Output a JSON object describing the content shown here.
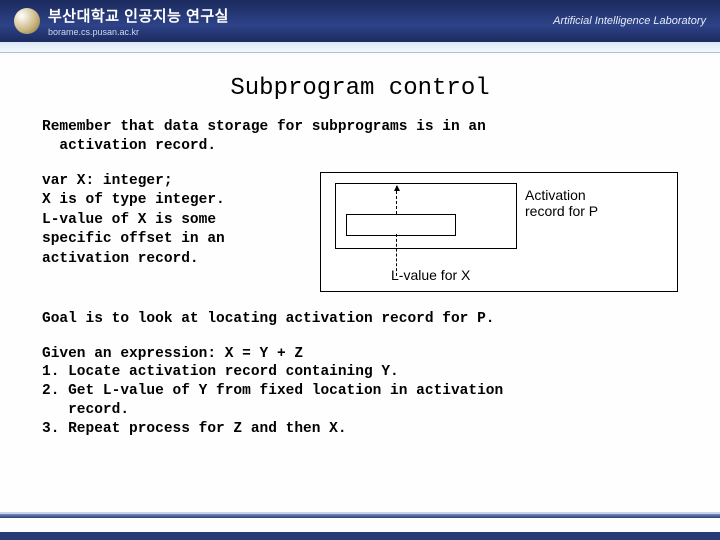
{
  "header": {
    "lab_name_kr": "부산대학교 인공지능 연구실",
    "lab_url": "borame.cs.pusan.ac.kr",
    "lab_name_en": "Artificial Intelligence Laboratory"
  },
  "title": "Subprogram control",
  "intro": "Remember that data storage for subprograms is in an\n  activation record.",
  "code_block": "var X: integer;\nX is of type integer.\nL-value of X is some\nspecific offset in an\nactivation record.",
  "diagram": {
    "ar_label": "Activation\nrecord for P",
    "lvalue_label": "L-value for X"
  },
  "goal": "Goal is to look at locating activation record for P.",
  "steps": "Given an expression: X = Y + Z\n1. Locate activation record containing Y.\n2. Get L-value of Y from fixed location in activation\n   record.\n3. Repeat process for Z and then X."
}
